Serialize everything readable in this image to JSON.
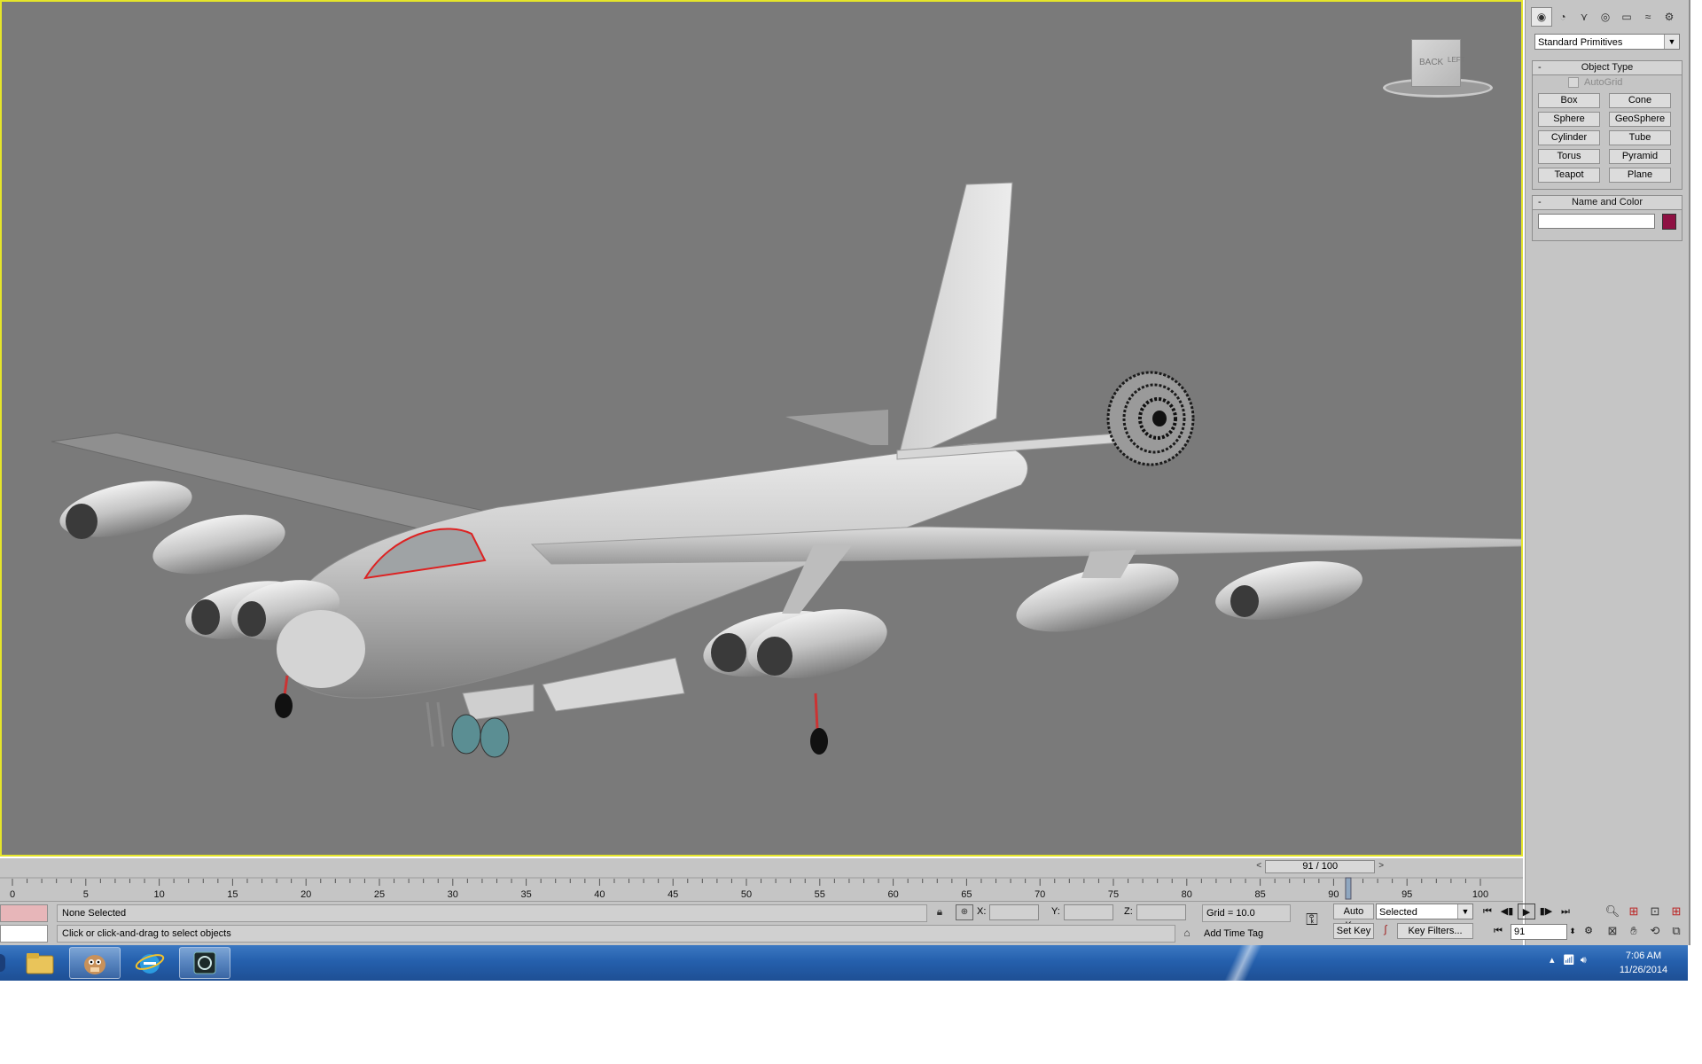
{
  "viewcube": {
    "back_label": "BACK",
    "left_label": "LEFT"
  },
  "command_panel": {
    "category_dropdown": "Standard Primitives",
    "object_type": {
      "title": "Object Type",
      "autogrid_label": "AutoGrid",
      "buttons": [
        "Box",
        "Cone",
        "Sphere",
        "GeoSphere",
        "Cylinder",
        "Tube",
        "Torus",
        "Pyramid",
        "Teapot",
        "Plane"
      ]
    },
    "name_and_color": {
      "title": "Name and Color",
      "name_value": "",
      "color": "#8e1143"
    }
  },
  "timeslider": {
    "label": "91 / 100",
    "current": 91,
    "total": 100
  },
  "trackbar": {
    "ticks": [
      0,
      5,
      10,
      15,
      20,
      25,
      30,
      35,
      40,
      45,
      50,
      55,
      60,
      65,
      70,
      75,
      80,
      85,
      90,
      95,
      100
    ]
  },
  "status": {
    "selection": "None Selected",
    "prompt": "Click or click-and-drag to select objects",
    "x_label": "X:",
    "y_label": "Y:",
    "z_label": "Z:",
    "grid": "Grid = 10.0",
    "add_time_tag": "Add Time Tag"
  },
  "animation": {
    "auto_key": "Auto Key",
    "set_key": "Set Key",
    "key_mode_dropdown": "Selected",
    "key_filters": "Key Filters...",
    "current_frame": "91"
  },
  "taskbar": {
    "time": "7:06 AM",
    "date": "11/26/2014"
  },
  "colors": {
    "viewport_bg": "#7a7a7a",
    "active_border": "#e5e52a",
    "panel_bg": "#c5c5c5"
  }
}
